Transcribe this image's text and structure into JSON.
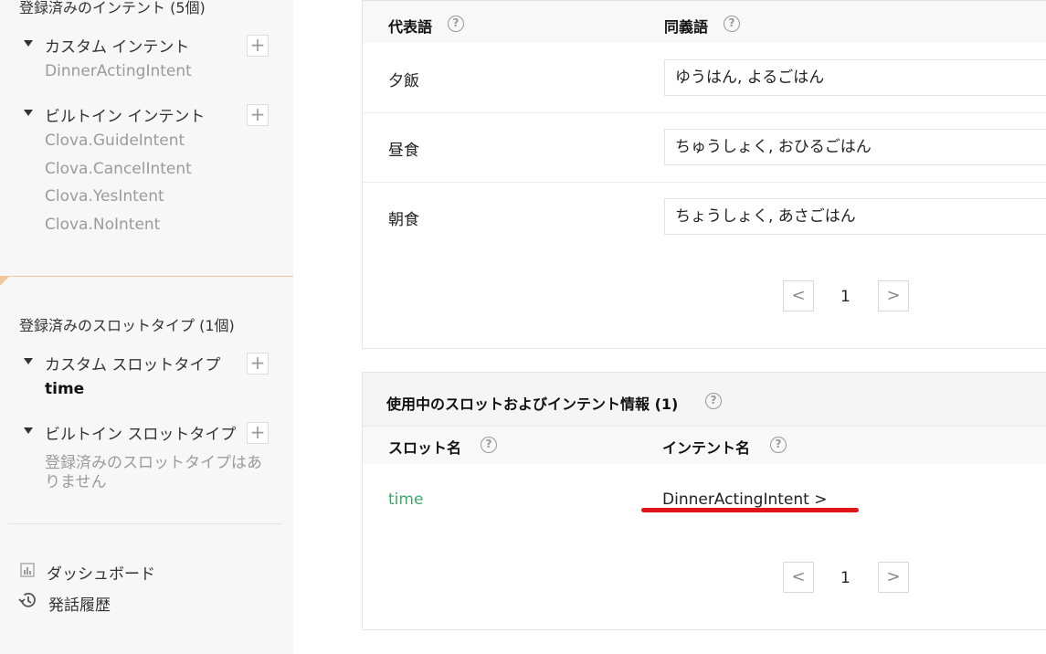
{
  "sidebar": {
    "intents_heading": "登録済みのインテント (5個)",
    "custom_intent_group": "カスタム インテント",
    "custom_intents": [
      "DinnerActingIntent"
    ],
    "builtin_intent_group": "ビルトイン インテント",
    "builtin_intents": [
      "Clova.GuideIntent",
      "Clova.CancelIntent",
      "Clova.YesIntent",
      "Clova.NoIntent"
    ],
    "slot_types_heading": "登録済みのスロットタイプ (1個)",
    "custom_slot_group": "カスタム スロットタイプ",
    "custom_slots": [
      "time"
    ],
    "builtin_slot_group": "ビルトイン スロットタイプ",
    "builtin_slot_empty_line1": "登録済みのスロットタイプはあ",
    "builtin_slot_empty_line2": "りません",
    "add_label": "+",
    "dashboard_label": "ダッシュボード",
    "history_label": "発話履歴"
  },
  "values_table": {
    "col_representative": "代表語",
    "col_synonyms": "同義語",
    "help_symbol": "?",
    "rows": [
      {
        "representative": "夕飯",
        "synonyms": "ゆうはん, よるごはん"
      },
      {
        "representative": "昼食",
        "synonyms": "ちゅうしょく, おひるごはん"
      },
      {
        "representative": "朝食",
        "synonyms": "ちょうしょく, あさごはん"
      }
    ],
    "pagination": {
      "prev": "<",
      "page": "1",
      "next": ">"
    }
  },
  "usage_section": {
    "title": "使用中のスロットおよびインテント情報 (1)",
    "col_slot": "スロット名",
    "col_intent": "インテント名",
    "rows": [
      {
        "slot": "time",
        "intent": "DinnerActingIntent >"
      }
    ],
    "pagination": {
      "prev": "<",
      "page": "1",
      "next": ">"
    }
  },
  "colors": {
    "slot_link": "#3ea66d",
    "annotation_underline": "#e0151a",
    "sidebar_accent": "#f0c89a"
  }
}
